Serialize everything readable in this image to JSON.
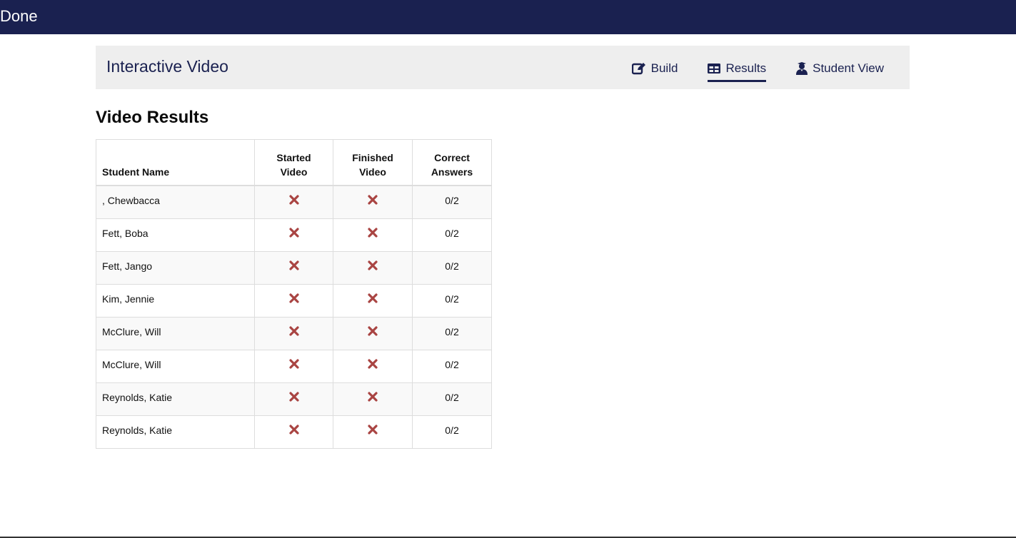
{
  "topbar": {
    "done_label": "Done"
  },
  "header": {
    "title": "Interactive Video",
    "tabs": [
      {
        "label": "Build",
        "icon": "edit-icon",
        "active": false
      },
      {
        "label": "Results",
        "icon": "table-icon",
        "active": true
      },
      {
        "label": "Student View",
        "icon": "student-icon",
        "active": false
      }
    ]
  },
  "section_title": "Video Results",
  "table": {
    "headers": {
      "name": "Student Name",
      "started_1": "Started",
      "started_2": "Video",
      "finished_1": "Finished",
      "finished_2": "Video",
      "correct_1": "Correct",
      "correct_2": "Answers"
    },
    "rows": [
      {
        "name": ", Chewbacca",
        "started": "x-icon",
        "finished": "x-icon",
        "correct": "0/2"
      },
      {
        "name": "Fett, Boba",
        "started": "x-icon",
        "finished": "x-icon",
        "correct": "0/2"
      },
      {
        "name": "Fett, Jango",
        "started": "x-icon",
        "finished": "x-icon",
        "correct": "0/2"
      },
      {
        "name": "Kim, Jennie",
        "started": "x-icon",
        "finished": "x-icon",
        "correct": "0/2"
      },
      {
        "name": "McClure, Will",
        "started": "x-icon",
        "finished": "x-icon",
        "correct": "0/2"
      },
      {
        "name": "McClure, Will",
        "started": "x-icon",
        "finished": "x-icon",
        "correct": "0/2"
      },
      {
        "name": "Reynolds, Katie",
        "started": "x-icon",
        "finished": "x-icon",
        "correct": "0/2"
      },
      {
        "name": "Reynolds, Katie",
        "started": "x-icon",
        "finished": "x-icon",
        "correct": "0/2"
      }
    ]
  },
  "colors": {
    "topbar": "#1a2150",
    "header_bg": "#eeeeee",
    "x_mark": "#a94442"
  }
}
